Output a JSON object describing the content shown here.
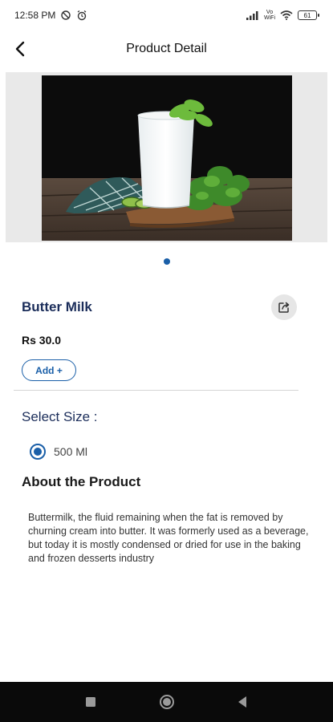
{
  "status_bar": {
    "time": "12:58 PM",
    "network_label_top": "Vo",
    "network_label_bottom": "WiFi",
    "battery": "61",
    "icons": [
      "data-saver-icon",
      "alarm-icon",
      "signal-icon",
      "wifi-icon",
      "battery-icon"
    ]
  },
  "header": {
    "title": "Product Detail",
    "back_icon": "back-arrow-icon"
  },
  "product": {
    "name": "Butter Milk",
    "price": "Rs 30.0",
    "add_label": "Add +",
    "image_description_icon": "product-photo",
    "share_icon": "share-icon",
    "carousel": {
      "count": 1,
      "active": 1,
      "active_color": "#1a5fa8"
    }
  },
  "size_section": {
    "title": "Select Size :",
    "options": [
      {
        "label": "500 Ml",
        "selected": true
      }
    ]
  },
  "about": {
    "title": "About the Product",
    "text": "Buttermilk, the fluid remaining when the fat is removed by churning cream into butter. It was formerly used as a beverage, but today it is mostly condensed or dried for use in the baking and frozen desserts industry"
  },
  "nav": {
    "icons": [
      "recent-apps-icon",
      "home-icon",
      "back-icon"
    ]
  },
  "colors": {
    "accent": "#1a5fa8",
    "title_text": "#1b2d5a",
    "nav_bar": "#0a0a0a"
  }
}
